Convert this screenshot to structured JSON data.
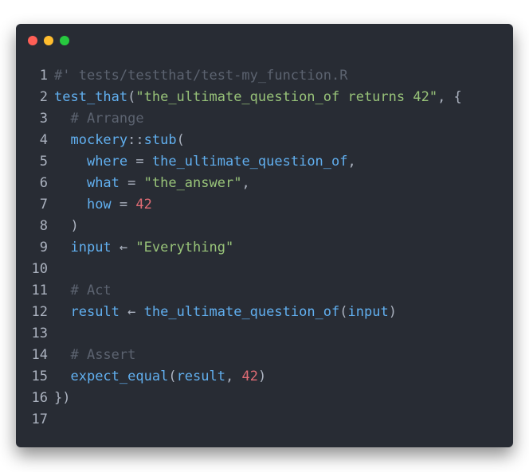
{
  "window": {
    "controls": [
      "close",
      "minimize",
      "maximize"
    ],
    "colors": {
      "close": "#ff5f56",
      "minimize": "#ffbd2e",
      "maximize": "#27c93f",
      "background": "#282c34"
    }
  },
  "code": {
    "language": "R",
    "lines": [
      {
        "n": "1",
        "tokens": [
          {
            "t": "#' tests/testthat/test-my_function.R",
            "k": "comment"
          }
        ]
      },
      {
        "n": "2",
        "tokens": [
          {
            "t": "test_that",
            "k": "fn"
          },
          {
            "t": "(",
            "k": "punc"
          },
          {
            "t": "\"the_ultimate_question_of returns 42\"",
            "k": "str"
          },
          {
            "t": ", {",
            "k": "punc"
          }
        ]
      },
      {
        "n": "3",
        "tokens": [
          {
            "t": "  ",
            "k": "punc"
          },
          {
            "t": "# Arrange",
            "k": "comment"
          }
        ]
      },
      {
        "n": "4",
        "tokens": [
          {
            "t": "  ",
            "k": "punc"
          },
          {
            "t": "mockery",
            "k": "fn"
          },
          {
            "t": "::",
            "k": "punc"
          },
          {
            "t": "stub",
            "k": "fn"
          },
          {
            "t": "(",
            "k": "punc"
          }
        ]
      },
      {
        "n": "5",
        "tokens": [
          {
            "t": "    ",
            "k": "punc"
          },
          {
            "t": "where",
            "k": "arg"
          },
          {
            "t": " = ",
            "k": "punc"
          },
          {
            "t": "the_ultimate_question_of",
            "k": "fn"
          },
          {
            "t": ",",
            "k": "punc"
          }
        ]
      },
      {
        "n": "6",
        "tokens": [
          {
            "t": "    ",
            "k": "punc"
          },
          {
            "t": "what",
            "k": "arg"
          },
          {
            "t": " = ",
            "k": "punc"
          },
          {
            "t": "\"the_answer\"",
            "k": "str"
          },
          {
            "t": ",",
            "k": "punc"
          }
        ]
      },
      {
        "n": "7",
        "tokens": [
          {
            "t": "    ",
            "k": "punc"
          },
          {
            "t": "how",
            "k": "arg"
          },
          {
            "t": " = ",
            "k": "punc"
          },
          {
            "t": "42",
            "k": "num"
          }
        ]
      },
      {
        "n": "8",
        "tokens": [
          {
            "t": "  )",
            "k": "punc"
          }
        ]
      },
      {
        "n": "9",
        "tokens": [
          {
            "t": "  ",
            "k": "punc"
          },
          {
            "t": "input",
            "k": "arg"
          },
          {
            "t": " ← ",
            "k": "punc"
          },
          {
            "t": "\"Everything\"",
            "k": "str"
          }
        ]
      },
      {
        "n": "10",
        "tokens": []
      },
      {
        "n": "11",
        "tokens": [
          {
            "t": "  ",
            "k": "punc"
          },
          {
            "t": "# Act",
            "k": "comment"
          }
        ]
      },
      {
        "n": "12",
        "tokens": [
          {
            "t": "  ",
            "k": "punc"
          },
          {
            "t": "result",
            "k": "arg"
          },
          {
            "t": " ← ",
            "k": "punc"
          },
          {
            "t": "the_ultimate_question_of",
            "k": "fn"
          },
          {
            "t": "(",
            "k": "punc"
          },
          {
            "t": "input",
            "k": "arg"
          },
          {
            "t": ")",
            "k": "punc"
          }
        ]
      },
      {
        "n": "13",
        "tokens": []
      },
      {
        "n": "14",
        "tokens": [
          {
            "t": "  ",
            "k": "punc"
          },
          {
            "t": "# Assert",
            "k": "comment"
          }
        ]
      },
      {
        "n": "15",
        "tokens": [
          {
            "t": "  ",
            "k": "punc"
          },
          {
            "t": "expect_equal",
            "k": "fn"
          },
          {
            "t": "(",
            "k": "punc"
          },
          {
            "t": "result",
            "k": "arg"
          },
          {
            "t": ", ",
            "k": "punc"
          },
          {
            "t": "42",
            "k": "num"
          },
          {
            "t": ")",
            "k": "punc"
          }
        ]
      },
      {
        "n": "16",
        "tokens": [
          {
            "t": "})",
            "k": "punc"
          }
        ]
      },
      {
        "n": "17",
        "tokens": []
      }
    ]
  }
}
